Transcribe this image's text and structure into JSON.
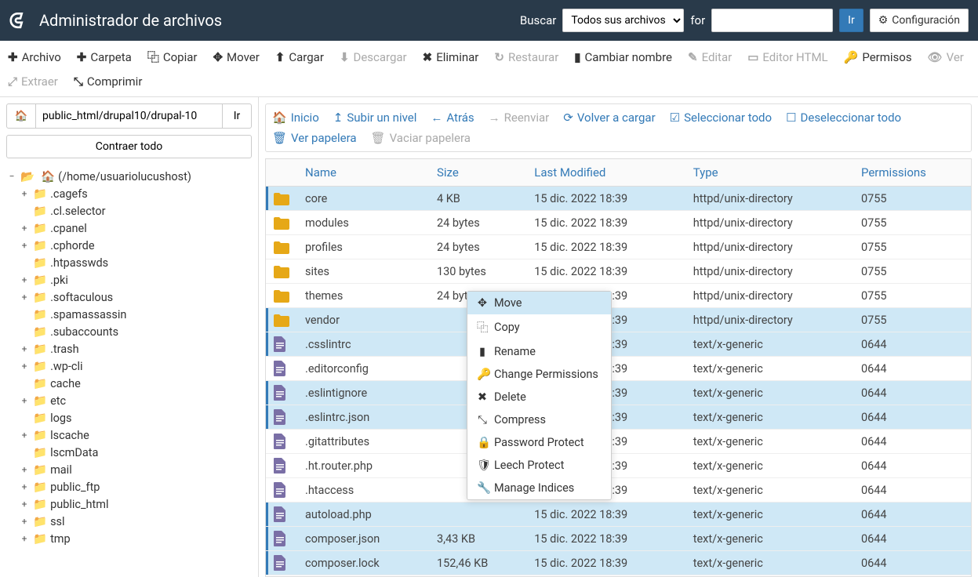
{
  "header": {
    "title": "Administrador de archivos",
    "search_label": "Buscar",
    "search_select": "Todos sus archivos",
    "for_label": "for",
    "go": "Ir",
    "config": "Configuración"
  },
  "toolbar": {
    "file": "Archivo",
    "folder": "Carpeta",
    "copy": "Copiar",
    "move": "Mover",
    "upload": "Cargar",
    "download": "Descargar",
    "delete": "Eliminar",
    "restore": "Restaurar",
    "rename": "Cambiar nombre",
    "edit": "Editar",
    "html_editor": "Editor HTML",
    "permissions": "Permisos",
    "view": "Ver",
    "extract": "Extraer",
    "compress": "Comprimir"
  },
  "path": {
    "value": "public_html/drupal10/drupal-10",
    "go": "Ir",
    "collapse": "Contraer todo",
    "root": "(/home/usuariolucushost)"
  },
  "tree": [
    {
      "depth": 1,
      "toggle": "+",
      "icon": "fc",
      "label": ".cagefs"
    },
    {
      "depth": 1,
      "toggle": "",
      "icon": "fc",
      "label": ".cl.selector"
    },
    {
      "depth": 1,
      "toggle": "+",
      "icon": "fc",
      "label": ".cpanel"
    },
    {
      "depth": 1,
      "toggle": "+",
      "icon": "fc",
      "label": ".cphorde"
    },
    {
      "depth": 1,
      "toggle": "",
      "icon": "fc",
      "label": ".htpasswds"
    },
    {
      "depth": 1,
      "toggle": "+",
      "icon": "fc",
      "label": ".pki"
    },
    {
      "depth": 1,
      "toggle": "+",
      "icon": "fc",
      "label": ".softaculous"
    },
    {
      "depth": 1,
      "toggle": "",
      "icon": "fc",
      "label": ".spamassassin"
    },
    {
      "depth": 1,
      "toggle": "",
      "icon": "fc",
      "label": ".subaccounts"
    },
    {
      "depth": 1,
      "toggle": "+",
      "icon": "fc",
      "label": ".trash"
    },
    {
      "depth": 1,
      "toggle": "+",
      "icon": "fc",
      "label": ".wp-cli"
    },
    {
      "depth": 1,
      "toggle": "",
      "icon": "fc",
      "label": "cache"
    },
    {
      "depth": 1,
      "toggle": "+",
      "icon": "fc",
      "label": "etc"
    },
    {
      "depth": 1,
      "toggle": "",
      "icon": "fc",
      "label": "logs"
    },
    {
      "depth": 1,
      "toggle": "+",
      "icon": "fc",
      "label": "lscache"
    },
    {
      "depth": 1,
      "toggle": "",
      "icon": "fc",
      "label": "lscmData"
    },
    {
      "depth": 1,
      "toggle": "+",
      "icon": "fc",
      "label": "mail"
    },
    {
      "depth": 1,
      "toggle": "+",
      "icon": "fc",
      "label": "public_ftp"
    },
    {
      "depth": 1,
      "toggle": "+",
      "icon": "fc",
      "label": "public_html"
    },
    {
      "depth": 1,
      "toggle": "+",
      "icon": "fc",
      "label": "ssl"
    },
    {
      "depth": 1,
      "toggle": "+",
      "icon": "fc",
      "label": "tmp"
    }
  ],
  "nav": {
    "home": "Inicio",
    "up": "Subir un nivel",
    "back": "Atrás",
    "forward": "Reenviar",
    "reload": "Volver a cargar",
    "select_all": "Seleccionar todo",
    "deselect_all": "Deseleccionar todo",
    "view_trash": "Ver papelera",
    "empty_trash": "Vaciar papelera"
  },
  "columns": {
    "name": "Name",
    "size": "Size",
    "modified": "Last Modified",
    "type": "Type",
    "permissions": "Permissions"
  },
  "rows": [
    {
      "sel": true,
      "icon": "dir",
      "name": "core",
      "size": "4 KB",
      "mod": "15 dic. 2022 18:39",
      "type": "httpd/unix-directory",
      "perm": "0755"
    },
    {
      "sel": false,
      "icon": "dir",
      "name": "modules",
      "size": "24 bytes",
      "mod": "15 dic. 2022 18:39",
      "type": "httpd/unix-directory",
      "perm": "0755"
    },
    {
      "sel": false,
      "icon": "dir",
      "name": "profiles",
      "size": "24 bytes",
      "mod": "15 dic. 2022 18:39",
      "type": "httpd/unix-directory",
      "perm": "0755"
    },
    {
      "sel": false,
      "icon": "dir",
      "name": "sites",
      "size": "130 bytes",
      "mod": "15 dic. 2022 18:39",
      "type": "httpd/unix-directory",
      "perm": "0755"
    },
    {
      "sel": false,
      "icon": "dir",
      "name": "themes",
      "size": "24 bytes",
      "mod": "15 dic. 2022 18:39",
      "type": "httpd/unix-directory",
      "perm": "0755"
    },
    {
      "sel": true,
      "icon": "dir",
      "name": "vendor",
      "size": "",
      "mod": "15 dic. 2022 18:39",
      "type": "httpd/unix-directory",
      "perm": "0755"
    },
    {
      "sel": true,
      "icon": "file",
      "name": ".csslintrc",
      "size": "",
      "mod": "15 dic. 2022 18:39",
      "type": "text/x-generic",
      "perm": "0644"
    },
    {
      "sel": false,
      "icon": "file",
      "name": ".editorconfig",
      "size": "",
      "mod": "15 dic. 2022 18:39",
      "type": "text/x-generic",
      "perm": "0644"
    },
    {
      "sel": true,
      "icon": "file",
      "name": ".eslintignore",
      "size": "",
      "mod": "15 dic. 2022 18:39",
      "type": "text/x-generic",
      "perm": "0644"
    },
    {
      "sel": true,
      "icon": "file",
      "name": ".eslintrc.json",
      "size": "",
      "mod": "15 dic. 2022 18:39",
      "type": "text/x-generic",
      "perm": "0644"
    },
    {
      "sel": false,
      "icon": "file",
      "name": ".gitattributes",
      "size": "",
      "mod": "15 dic. 2022 18:39",
      "type": "text/x-generic",
      "perm": "0644"
    },
    {
      "sel": false,
      "icon": "file",
      "name": ".ht.router.php",
      "size": "",
      "mod": "15 dic. 2022 18:39",
      "type": "text/x-generic",
      "perm": "0644"
    },
    {
      "sel": false,
      "icon": "file",
      "name": ".htaccess",
      "size": "",
      "mod": "15 dic. 2022 18:39",
      "type": "text/x-generic",
      "perm": "0644"
    },
    {
      "sel": true,
      "icon": "file",
      "name": "autoload.php",
      "size": "",
      "mod": "15 dic. 2022 18:39",
      "type": "text/x-generic",
      "perm": "0644"
    },
    {
      "sel": true,
      "icon": "file",
      "name": "composer.json",
      "size": "3,43 KB",
      "mod": "15 dic. 2022 18:39",
      "type": "text/x-generic",
      "perm": "0644"
    },
    {
      "sel": true,
      "icon": "file",
      "name": "composer.lock",
      "size": "152,46 KB",
      "mod": "15 dic. 2022 18:39",
      "type": "text/x-generic",
      "perm": "0644"
    }
  ],
  "ctx": {
    "move": "Move",
    "copy": "Copy",
    "rename": "Rename",
    "chperm": "Change Permissions",
    "delete": "Delete",
    "compress": "Compress",
    "pwd": "Password Protect",
    "leech": "Leech Protect",
    "indices": "Manage Indices"
  }
}
